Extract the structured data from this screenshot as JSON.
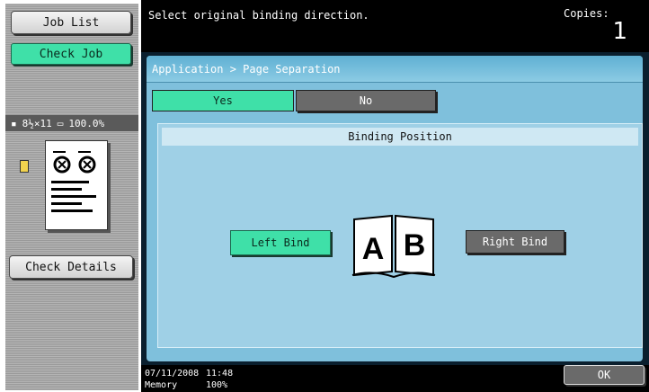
{
  "left_panel": {
    "job_list_label": "Job List",
    "check_job_label": "Check Job",
    "preview_paper": "8½×11",
    "preview_zoom": "100.0%",
    "check_details_label": "Check Details"
  },
  "topbar": {
    "message": "Select original binding direction.",
    "copies_label": "Copies:",
    "copies_value": "1"
  },
  "main": {
    "breadcrumb": "Application > Page Separation",
    "yes_label": "Yes",
    "no_label": "No",
    "binding_header": "Binding Position",
    "left_bind_label": "Left Bind",
    "right_bind_label": "Right Bind",
    "book_letters": [
      "A",
      "B"
    ]
  },
  "status": {
    "date": "07/11/2008",
    "time": "11:48",
    "memory_label": "Memory",
    "memory_value": "100%",
    "ok_label": "OK"
  },
  "colors": {
    "accent_green": "#3fe0a8",
    "panel_blue": "#7fc0dc",
    "dark": "#000000"
  }
}
